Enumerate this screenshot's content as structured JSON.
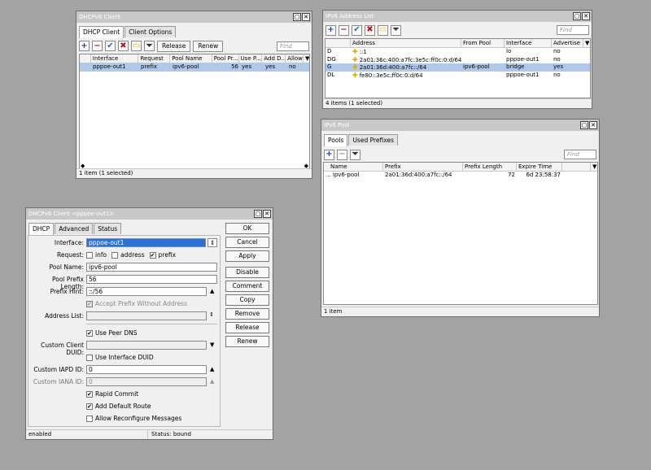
{
  "dhcp_client": {
    "title": "DHCPv6 Client",
    "tabs": [
      "DHCP Client",
      "Client Options"
    ],
    "buttons": {
      "release": "Release",
      "renew": "Renew"
    },
    "find_placeholder": "Find",
    "columns": [
      "Interface",
      "Request",
      "Pool Name",
      "Pool Pr...",
      "Use P...",
      "Add D...",
      "Allow ..."
    ],
    "rows": [
      {
        "interface": "pppoe-out1",
        "request": "prefix",
        "pool_name": "ipv6-pool",
        "pool_prefix": "56",
        "use_peer": "yes",
        "add_default": "yes",
        "allow": "no"
      }
    ],
    "status": "1 item (1 selected)"
  },
  "ipv6_address_list": {
    "title": "IPv6 Address List",
    "find_placeholder": "Find",
    "columns": [
      "",
      "Address",
      "From Pool",
      "Interface",
      "Advertise"
    ],
    "rows": [
      {
        "flag": "D",
        "address": "::1",
        "from_pool": "",
        "interface": "lo",
        "advertise": "no"
      },
      {
        "flag": "DG",
        "address": "2a01:36c:400:a7fc:3e5c:ff0c:0:d/64",
        "from_pool": "",
        "interface": "pppoe-out1",
        "advertise": "no"
      },
      {
        "flag": "G",
        "address": "2a01:36d:400:a7fc::/64",
        "from_pool": "ipv6-pool",
        "interface": "bridge",
        "advertise": "yes"
      },
      {
        "flag": "DL",
        "address": "fe80::3e5c:ff0c:0:d/64",
        "from_pool": "",
        "interface": "pppoe-out1",
        "advertise": "no"
      }
    ],
    "status": "4 items (1 selected)"
  },
  "ipv6_pool": {
    "title": "IPv6 Pool",
    "tabs": [
      "Pools",
      "Used Prefixes"
    ],
    "find_placeholder": "Find",
    "columns": [
      "Name",
      "Prefix",
      "Prefix Length",
      "Expire Time"
    ],
    "rows": [
      {
        "name": "ipv6-pool",
        "prefix": "2a01:36d:400:a7fc::/64",
        "prefix_length": "72",
        "expire_time": "6d 23:58:37"
      }
    ],
    "status": "1 item"
  },
  "client_detail": {
    "title": "DHCPv6 Client <pppoe-out1>",
    "tabs": [
      "DHCP",
      "Advanced",
      "Status"
    ],
    "labels": {
      "interface": "Interface:",
      "request": "Request:",
      "pool_name": "Pool Name:",
      "pool_prefix_length": "Pool Prefix Length:",
      "prefix_hint": "Prefix Hint:",
      "address_list": "Address List:",
      "custom_client_duid": "Custom Client DUID:",
      "custom_iapd_id": "Custom IAPD ID:",
      "custom_iana_id": "Custom IANA ID:"
    },
    "values": {
      "interface": "pppoe-out1",
      "pool_name": "ipv6-pool",
      "pool_prefix_length": "56",
      "prefix_hint": "::/56",
      "address_list": "",
      "custom_client_duid": "",
      "custom_iapd_id": "0",
      "custom_iana_id": "0"
    },
    "request_options": {
      "info": "info",
      "address": "address",
      "prefix": "prefix"
    },
    "checkboxes": {
      "accept_prefix_without_address": "Accept Prefix Without Address",
      "use_peer_dns": "Use Peer DNS",
      "use_interface_duid": "Use Interface DUID",
      "rapid_commit": "Rapid Commit",
      "add_default_route": "Add Default Route",
      "allow_reconfigure_messages": "Allow Reconfigure Messages"
    },
    "buttons": [
      "OK",
      "Cancel",
      "Apply",
      "Disable",
      "Comment",
      "Copy",
      "Remove",
      "Release",
      "Renew"
    ],
    "status_left": "enabled",
    "status_right": "Status: bound"
  }
}
